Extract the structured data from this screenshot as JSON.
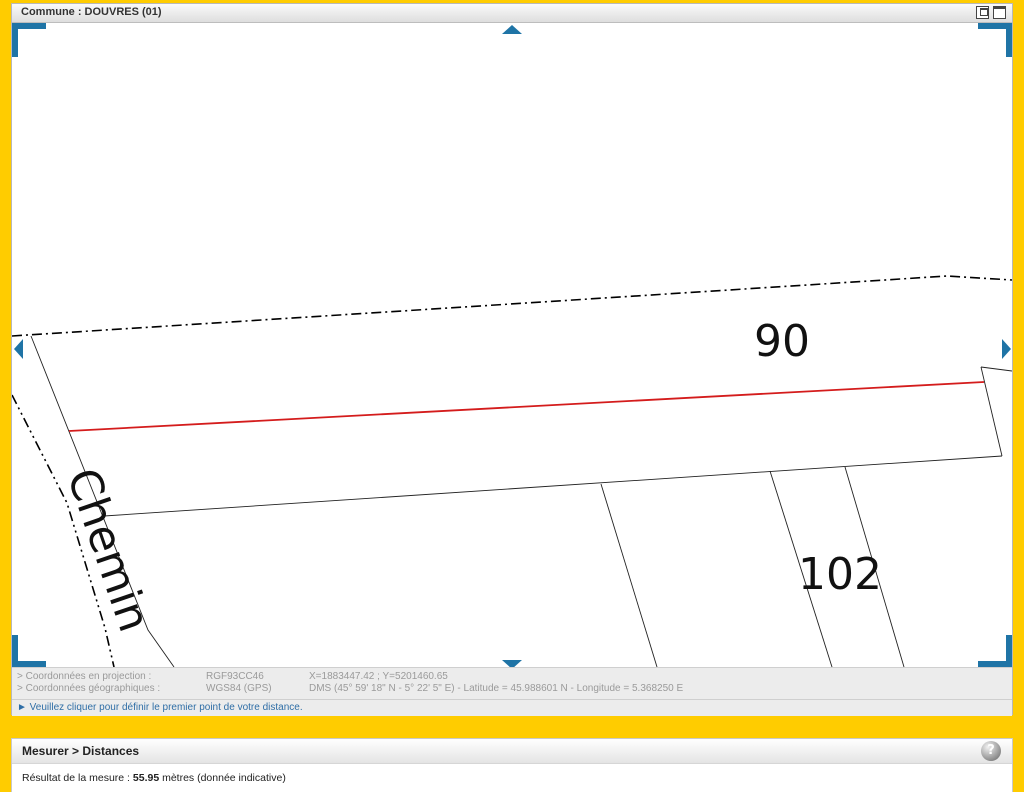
{
  "window": {
    "title": "Commune : DOUVRES (01)"
  },
  "map": {
    "parcel_labels": [
      "90",
      "102"
    ],
    "road_label": "Chemin",
    "line_colors": {
      "parcel": "#222222",
      "boundary_dashdot": "#000000",
      "measure": "#d41c1c",
      "pan_arrows": "#1f74a6",
      "corner_marks": "#1f74a6"
    }
  },
  "coords": {
    "projection_label": "> Coordonnées en projection :",
    "projection_system": "RGF93CC46",
    "projection_value": "X=1883447.42 ; Y=5201460.65",
    "geo_label": "> Coordonnées géographiques :",
    "geo_system": "WGS84 (GPS)",
    "geo_value": "DMS (45° 59' 18\" N - 5° 22' 5\" E) - Latitude = 45.988601 N - Longitude = 5.368250 E"
  },
  "instruction": "► Veuillez cliquer pour définir le premier point de votre distance.",
  "measure": {
    "title": "Mesurer > Distances",
    "result_prefix": "Résultat de la mesure : ",
    "result_value": "55.95",
    "result_suffix": " mètres (donnée indicative)",
    "help_symbol": "?"
  },
  "colors": {
    "background": "#FFCC00",
    "accent": "#1f74a6"
  }
}
